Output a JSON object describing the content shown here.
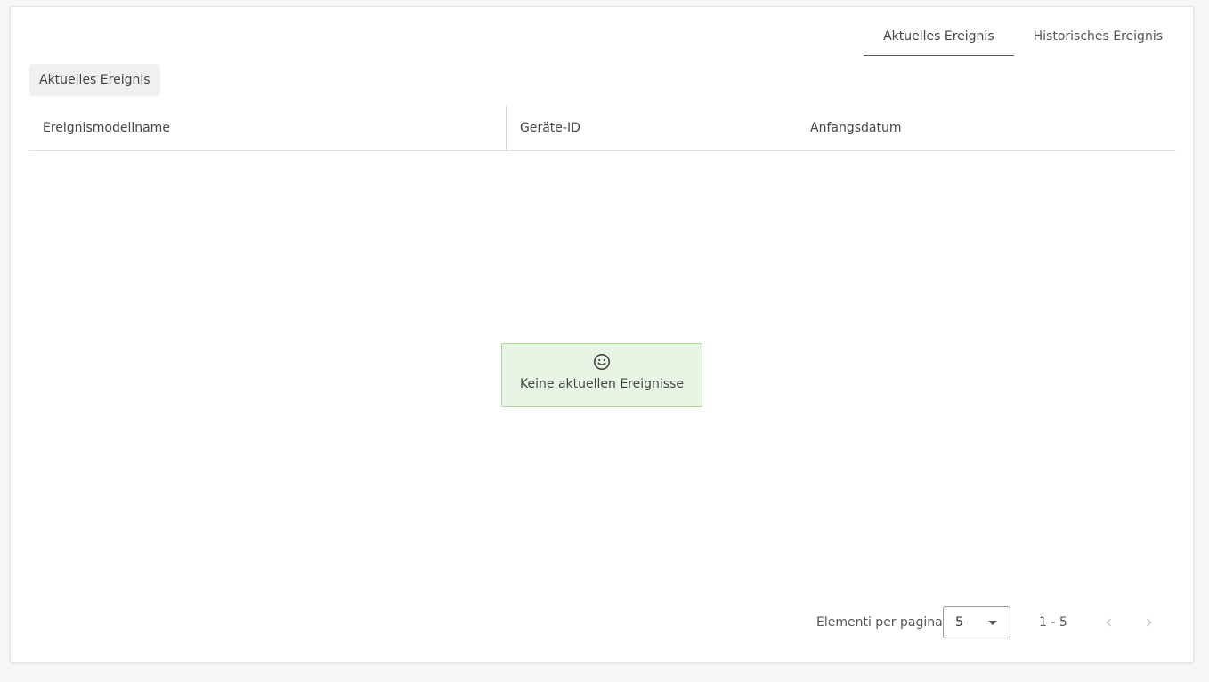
{
  "tabs": [
    {
      "label": "Aktuelles Ereignis",
      "active": true
    },
    {
      "label": "Historisches Ereignis",
      "active": false
    }
  ],
  "section_title": "Aktuelles Ereignis",
  "table": {
    "columns": [
      "Ereignismodellname",
      "Geräte-ID",
      "Anfangsdatum"
    ],
    "rows": []
  },
  "empty_state": {
    "icon": "smiley-icon",
    "message": "Keine aktuellen Ereignisse"
  },
  "pagination": {
    "items_per_page_label": "Elementi per pagina",
    "page_size": "5",
    "range": "1 - 5",
    "prev_icon": "chevron-left-icon",
    "next_icon": "chevron-right-icon"
  },
  "colors": {
    "empty_bg": "#e8f5e4",
    "empty_border": "#a8d99a"
  }
}
